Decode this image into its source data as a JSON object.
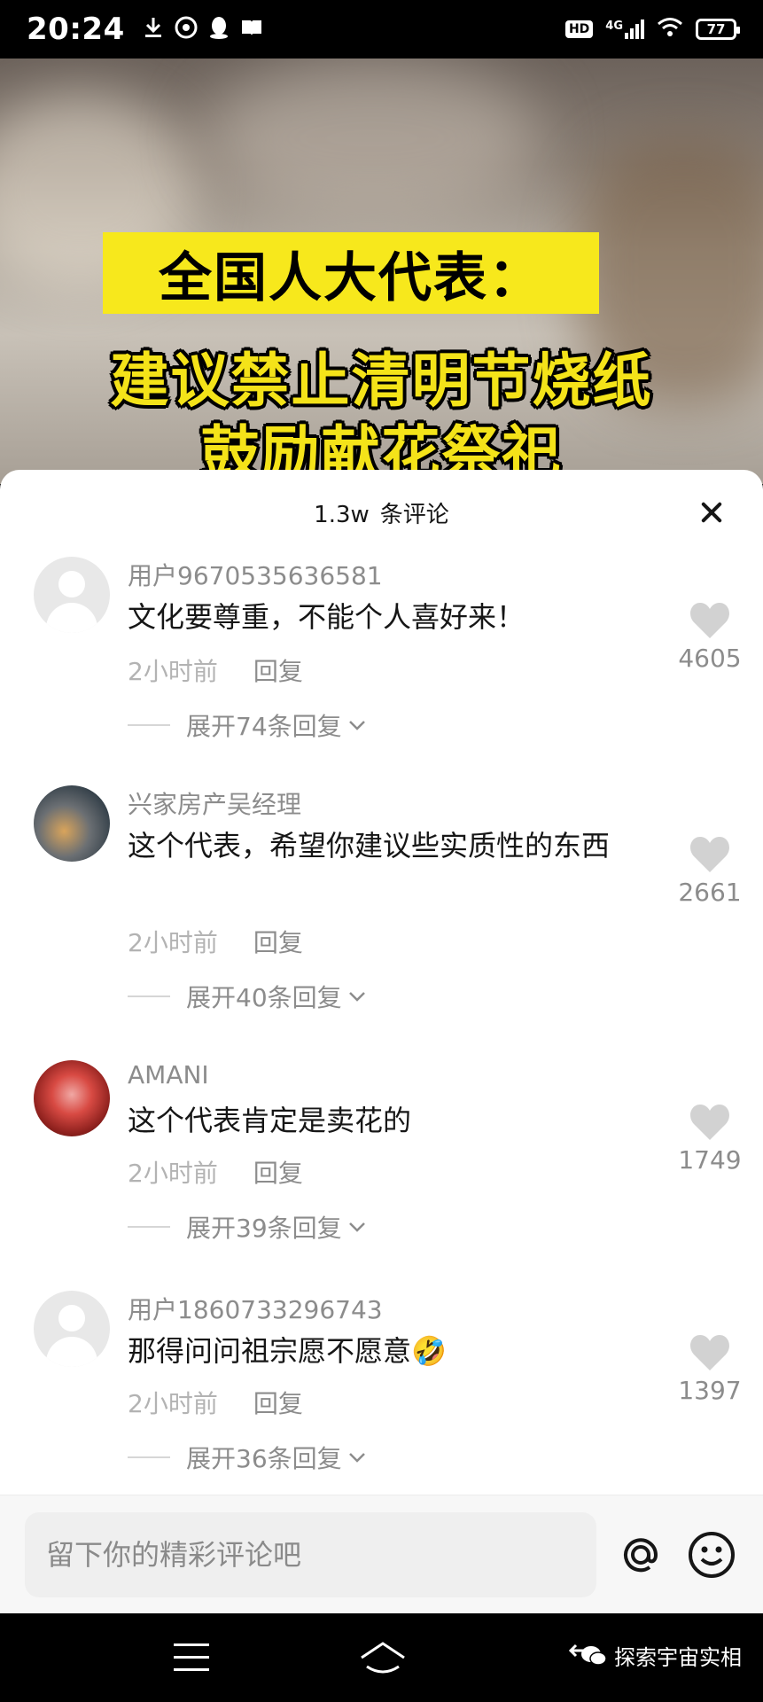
{
  "status_bar": {
    "time": "20:24",
    "hd": "HD",
    "network": "4G",
    "battery": "77"
  },
  "video": {
    "caption_line1": "全国人大代表：",
    "caption_line2": "建议禁止清明节烧纸",
    "caption_line3": "鼓励献花祭祀"
  },
  "comments_panel": {
    "count": "1.3w",
    "count_label": "条评论",
    "comments": [
      {
        "user": "用户9670535636581",
        "text": "文化要尊重，不能个人喜好来！",
        "time": "2小时前",
        "reply": "回复",
        "likes": "4605",
        "expand": "展开74条回复"
      },
      {
        "user": "兴家房产吴经理",
        "text": "这个代表，希望你建议些实质性的东西",
        "time": "2小时前",
        "reply": "回复",
        "likes": "2661",
        "expand": "展开40条回复"
      },
      {
        "user": "AMANI",
        "text": "这个代表肯定是卖花的",
        "time": "2小时前",
        "reply": "回复",
        "likes": "1749",
        "expand": "展开39条回复"
      },
      {
        "user": "用户1860733296743",
        "text": "那得问问祖宗愿不愿意",
        "emoji": "🤣",
        "time": "2小时前",
        "reply": "回复",
        "likes": "1397",
        "expand": "展开36条回复"
      }
    ]
  },
  "input_bar": {
    "placeholder": "留下你的精彩评论吧"
  },
  "watermark": "探索宇宙实相"
}
